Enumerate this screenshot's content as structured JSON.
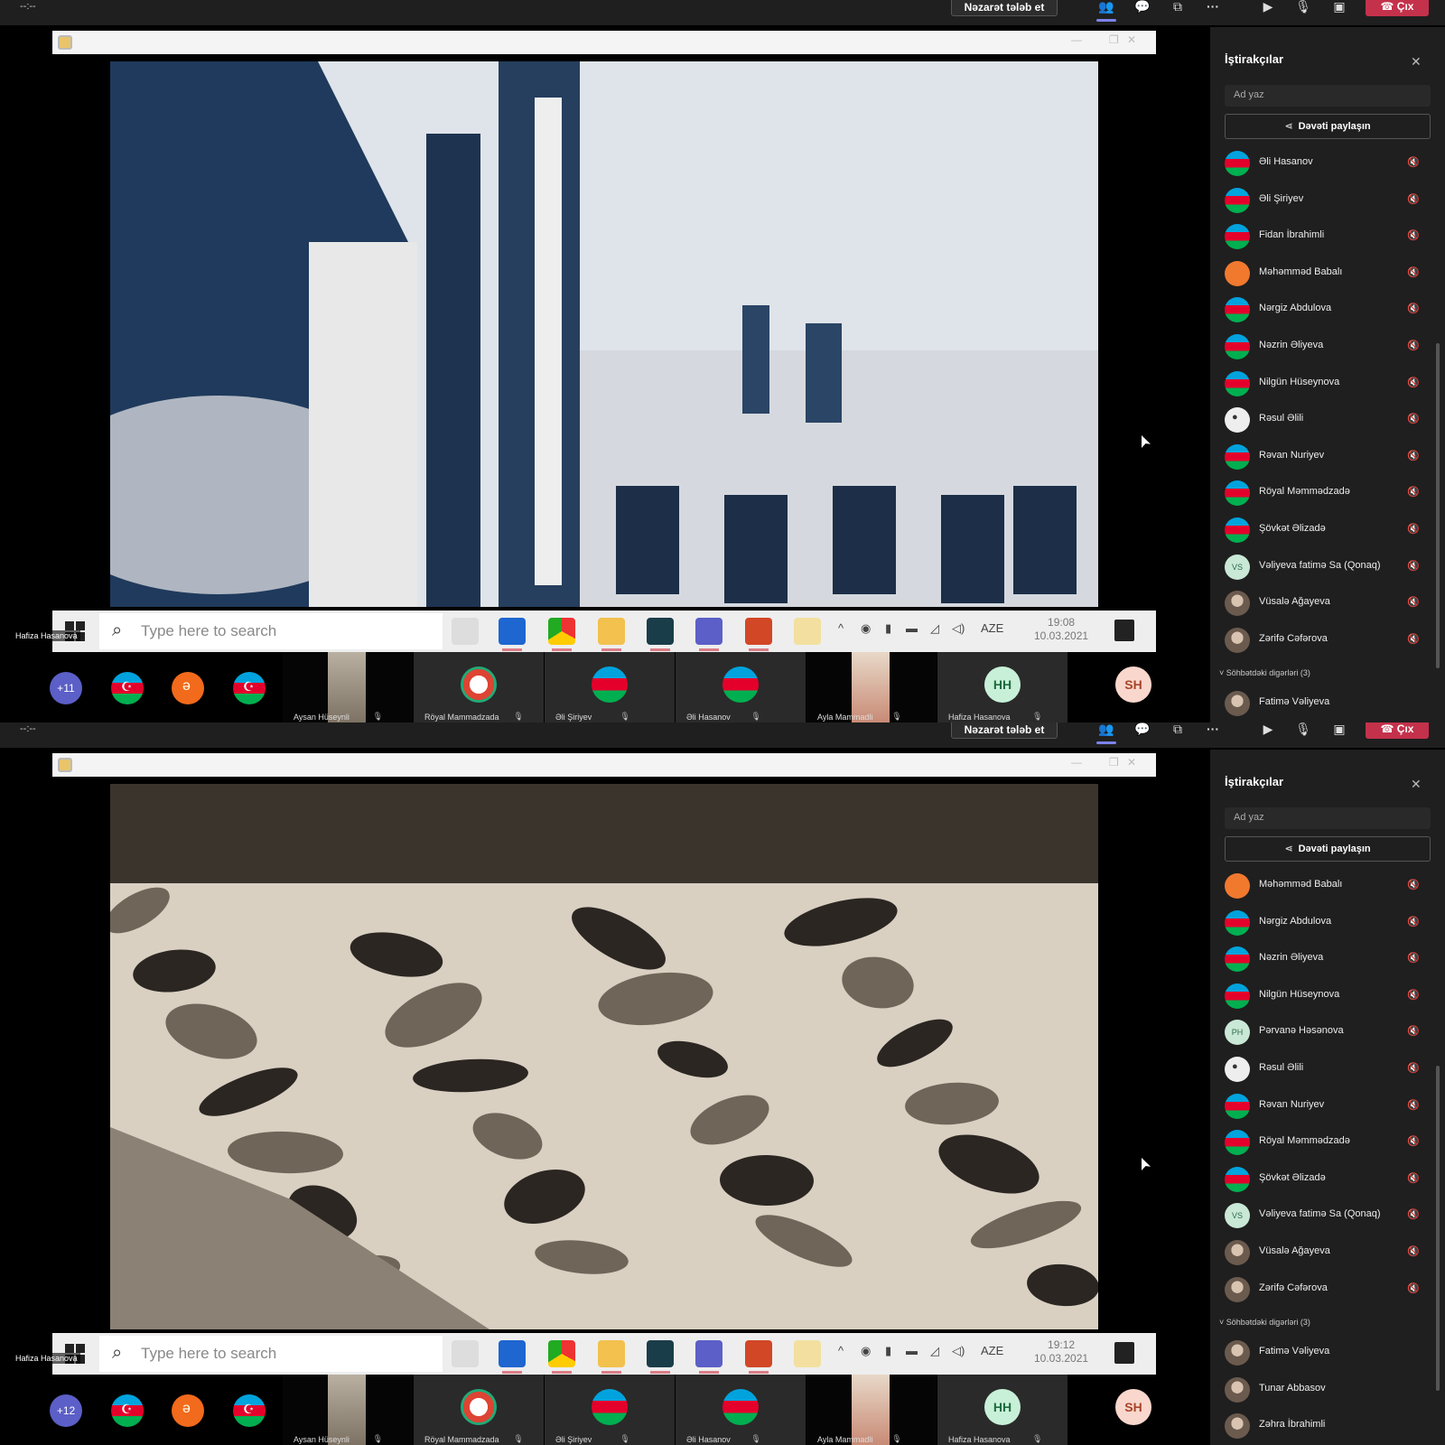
{
  "panels": [
    {
      "top_timer": "--:--",
      "request_control": "Nəzarət tələb et",
      "leave": "Çıx",
      "toolbar_icons": [
        "people-icon",
        "chat-icon",
        "breakout-rooms-icon",
        "more-icon",
        "camera-off-icon",
        "mic-off-icon",
        "share-tray-icon"
      ],
      "taskbar": {
        "search_placeholder": "Type here to search",
        "tray_lang": "AZE",
        "time": "19:08",
        "date": "10.03.2021"
      },
      "presenter": "Hafiza Hasanova",
      "strip": {
        "overflow_count": "+11",
        "tiles": [
          "Aysan Hüseynli",
          "Röyal Mammadzada",
          "Əli Şiriyev",
          "Əli Hasanov",
          "Ayla Mammadli",
          "Hafiza Hasanova"
        ],
        "initials": [
          "HH",
          "SH"
        ]
      },
      "pane": {
        "title": "İştirakçılar",
        "search_placeholder": "Ad yaz",
        "invite": "Dəvəti paylaşın",
        "participants": [
          "Əli Hasanov",
          "Əli Şiriyev",
          "Fidan İbrahimli",
          "Məhəmməd Babalı",
          "Nərgiz Abdulova",
          "Nəzrin Əliyeva",
          "Nilgün Hüseynova",
          "Rəsul Əlili",
          "Rəvan Nuriyev",
          "Röyal Məmmədzadə",
          "Şövkət Əlizadə",
          "Vəliyeva fatimə Sa (Qonaq)",
          "Vüsalə Ağayeva",
          "Zərifə Cəfərova"
        ],
        "group_header": "Söhbətdəki digərləri (3)",
        "others": [
          "Fatimə Vəliyeva"
        ]
      }
    },
    {
      "top_timer": "--:--",
      "request_control": "Nəzarət tələb et",
      "leave": "Çıx",
      "toolbar_icons": [
        "people-icon",
        "chat-icon",
        "breakout-rooms-icon",
        "more-icon",
        "camera-off-icon",
        "mic-off-icon",
        "share-tray-icon"
      ],
      "taskbar": {
        "search_placeholder": "Type here to search",
        "tray_lang": "AZE",
        "time": "19:12",
        "date": "10.03.2021"
      },
      "presenter": "Hafiza Hasanova",
      "strip": {
        "overflow_count": "+12",
        "tiles": [
          "Aysan Hüseynli",
          "Röyal Mammadzada",
          "Əli Şiriyev",
          "Əli Hasanov",
          "Ayla Mammadli",
          "Hafiza Hasanova"
        ],
        "initials": [
          "HH",
          "SH"
        ]
      },
      "pane": {
        "title": "İştirakçılar",
        "search_placeholder": "Ad yaz",
        "invite": "Dəvəti paylaşın",
        "participants": [
          "Məhəmməd Babalı",
          "Nərgiz Abdulova",
          "Nəzrin Əliyeva",
          "Nilgün Hüseynova",
          "Pərvanə Həsənova",
          "Rəsul Əlili",
          "Rəvan Nuriyev",
          "Röyal Məmmədzadə",
          "Şövkət Əlizadə",
          "Vəliyeva fatimə Sa (Qonaq)",
          "Vüsalə Ağayeva",
          "Zərifə Cəfərova"
        ],
        "group_header": "Söhbətdəki digərləri (3)",
        "others": [
          "Fatimə Vəliyeva",
          "Tunar Abbasov",
          "Zəhra İbrahimli"
        ]
      }
    }
  ],
  "colors": {
    "leave": "#c4314b",
    "accent": "#7b83eb",
    "pane_bg": "#1f1f1f",
    "strip_bg": "#000000"
  }
}
